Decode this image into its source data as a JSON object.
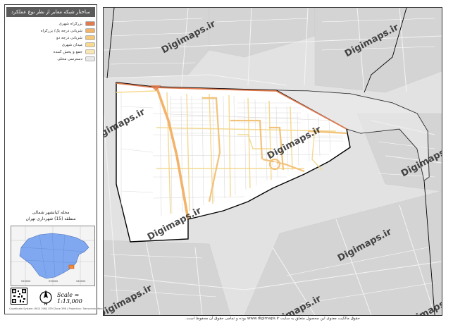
{
  "panel": {
    "title": "ساختار شبکه معابر از نظر نوع عملکرد",
    "district_line1": "محله کیانشهر شمالی",
    "district_line2": "منطقه (15) شهرداری تهران",
    "scale": "Scale = 1:13,000",
    "footer_note": "Coordinate System: WGS 1984 UTM Zone 39N | Projection: Transverse Mercator",
    "overview_ticks": [
      "520000",
      "530000",
      "540000"
    ]
  },
  "legend": [
    {
      "label": "بزرگراه شهری",
      "color": "#e07a4f"
    },
    {
      "label": "شریانی درجه یک/ بزرگراه",
      "color": "#f2b36b"
    },
    {
      "label": "شریانی درجه دو",
      "color": "#f5c97a"
    },
    {
      "label": "میدان شهری",
      "color": "#f7d98f"
    },
    {
      "label": "جمع و پخش کننده",
      "color": "#f9e6b3"
    },
    {
      "label": "دسترسی محلی",
      "color": "#e8e8e8"
    }
  ],
  "watermarks": [
    "Digimaps.ir",
    "Digimaps.ir",
    "Digimaps.ir",
    "Digimaps.ir",
    "Digimaps.ir",
    "Digimaps.ir",
    "Digimaps.ir",
    "Digimaps.ir",
    "Digimaps.ir",
    "Digimaps.ir"
  ],
  "copyright": "حقوق مالکیت معنوی این محصول متعلق به سایت www.digimaps.ir بوده و تمامی حقوق آن محفوظ است.",
  "colors": {
    "boundary": "#000000",
    "highway": "#e07a4f",
    "arterial": "#f2b36b",
    "collector": "#f9e6b3",
    "local": "#e8e8e8",
    "basemap": "#e2e2e2",
    "district_fill": "#ffffff",
    "overview_fill": "#7fa8f0"
  }
}
